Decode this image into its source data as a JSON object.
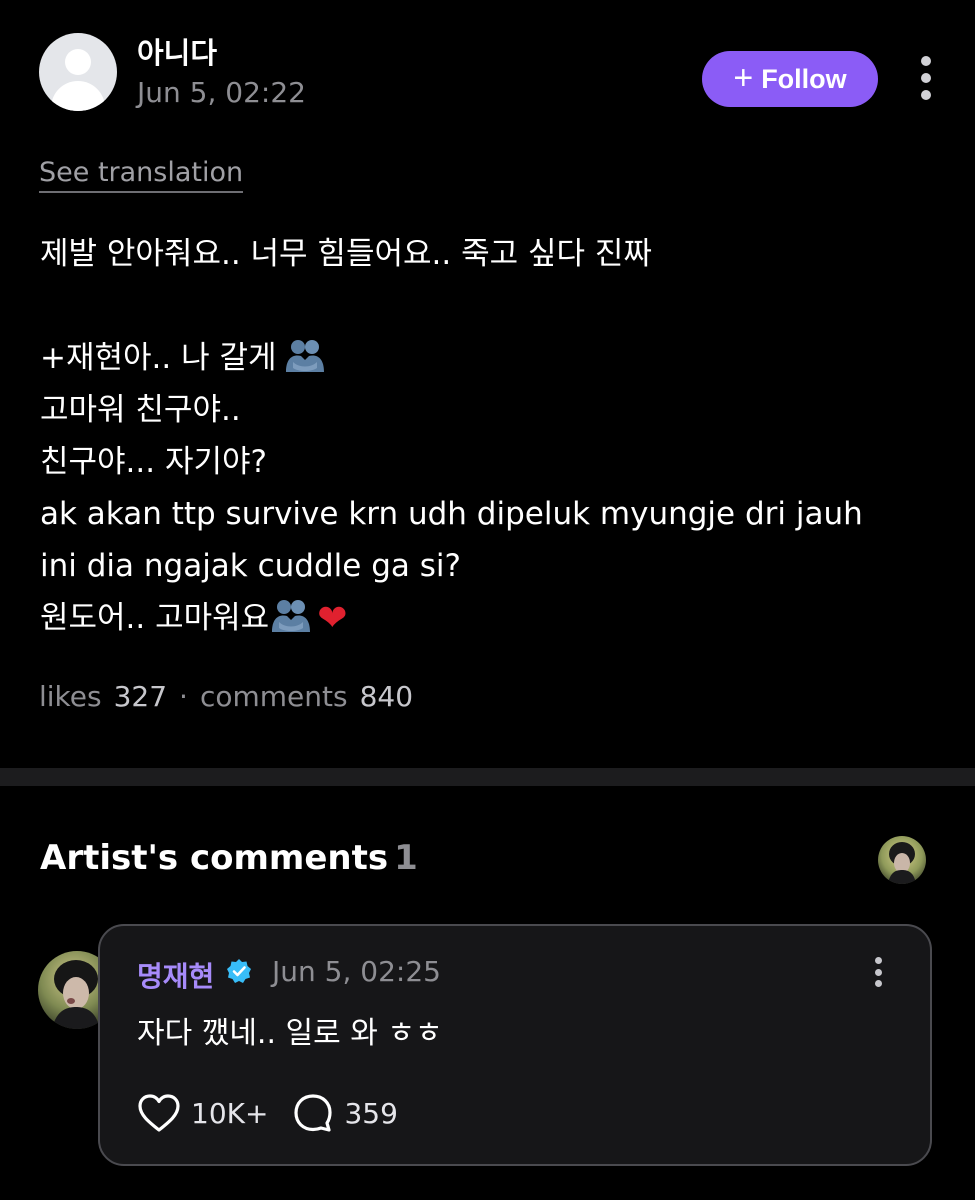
{
  "post": {
    "author": "아니다",
    "timestamp": "Jun 5, 02:22",
    "follow_label": "Follow",
    "translate_label": "See translation",
    "body_lines": {
      "l1": "제발 안아줘요.. 너무 힘들어요.. 죽고 싶다 진짜",
      "l2": "+재현아.. 나 갈게",
      "l3": "고마워 친구야..",
      "l4": "친구야... 자기야?",
      "l5": "ak akan ttp survive krn udh dipeluk myungje dri jauh",
      "l6": "ini dia ngajak cuddle ga si?",
      "l7": "원도어.. 고마워요"
    },
    "likes_label": "likes",
    "likes_count": "327",
    "separator": "·",
    "comments_label": "comments",
    "comments_count": "840"
  },
  "artist_comments": {
    "title": "Artist's comments",
    "count": "1",
    "comment": {
      "author": "명재현",
      "timestamp": "Jun 5, 02:25",
      "text": "자다 깼네.. 일로 와 ㅎㅎ",
      "likes": "10K+",
      "replies": "359"
    }
  },
  "icons": {
    "follow": "plus-icon",
    "post_menu": "more-vertical-icon",
    "comment_menu": "more-vertical-icon",
    "verified": "verified-badge-icon",
    "like": "heart-icon",
    "reply": "speech-bubble-icon",
    "emoji_hug": "people-hugging-emoji",
    "emoji_heart": "red-heart-emoji"
  },
  "colors": {
    "background": "#000000",
    "accent": "#8b5cf6",
    "artist_name": "#a78bfa",
    "verified": "#38bdf8",
    "muted_text": "#8e8e93",
    "card_border": "#4a4a4f"
  }
}
